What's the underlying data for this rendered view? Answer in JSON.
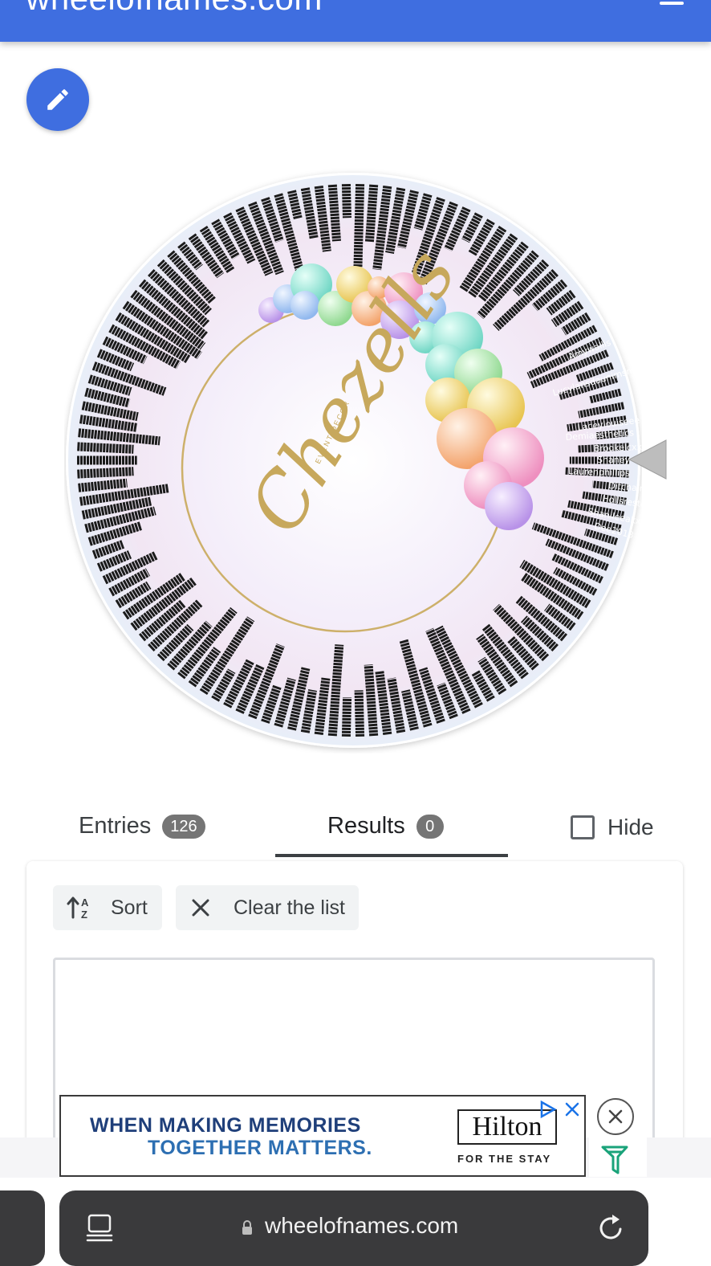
{
  "appbar": {
    "title": "wheelofnames.com",
    "menu_icon": "hamburger-menu-icon"
  },
  "fab": {
    "icon": "pencil-icon"
  },
  "wheel": {
    "center_logo": {
      "script_text": "Chezells",
      "small_text": "EVENT DECOR"
    },
    "visible_names": [
      "Amywallis",
      "Lucylansdaunimsmith",
      "Laceylouiseee",
      "Demiaesthetics",
      "Brookelcxx",
      "Shaney",
      "Laurenphillips",
      "Ditchair",
      "Hollsreste",
      "Shanileeakx",
      "Dee2013",
      "Deana",
      "Laurenpaget",
      "Hollymbaird",
      "Chloejade"
    ]
  },
  "tabs": {
    "entries": {
      "label": "Entries",
      "count": "126"
    },
    "results": {
      "label": "Results",
      "count": "0"
    },
    "hide": {
      "label": "Hide"
    }
  },
  "toolbar": {
    "sort_label": "Sort",
    "clear_label": "Clear the list"
  },
  "ad": {
    "headline_line1": "WHEN MAKING MEMORIES",
    "headline_line2": "TOGETHER MATTERS.",
    "brand": "Hilton",
    "tagline": "FOR THE STAY"
  },
  "browser": {
    "url": "wheelofnames.com"
  },
  "colors": {
    "brand_blue": "#3f6ee0",
    "wheel_text": "#1b1b1b",
    "browser_dark": "#3a3a3c"
  }
}
